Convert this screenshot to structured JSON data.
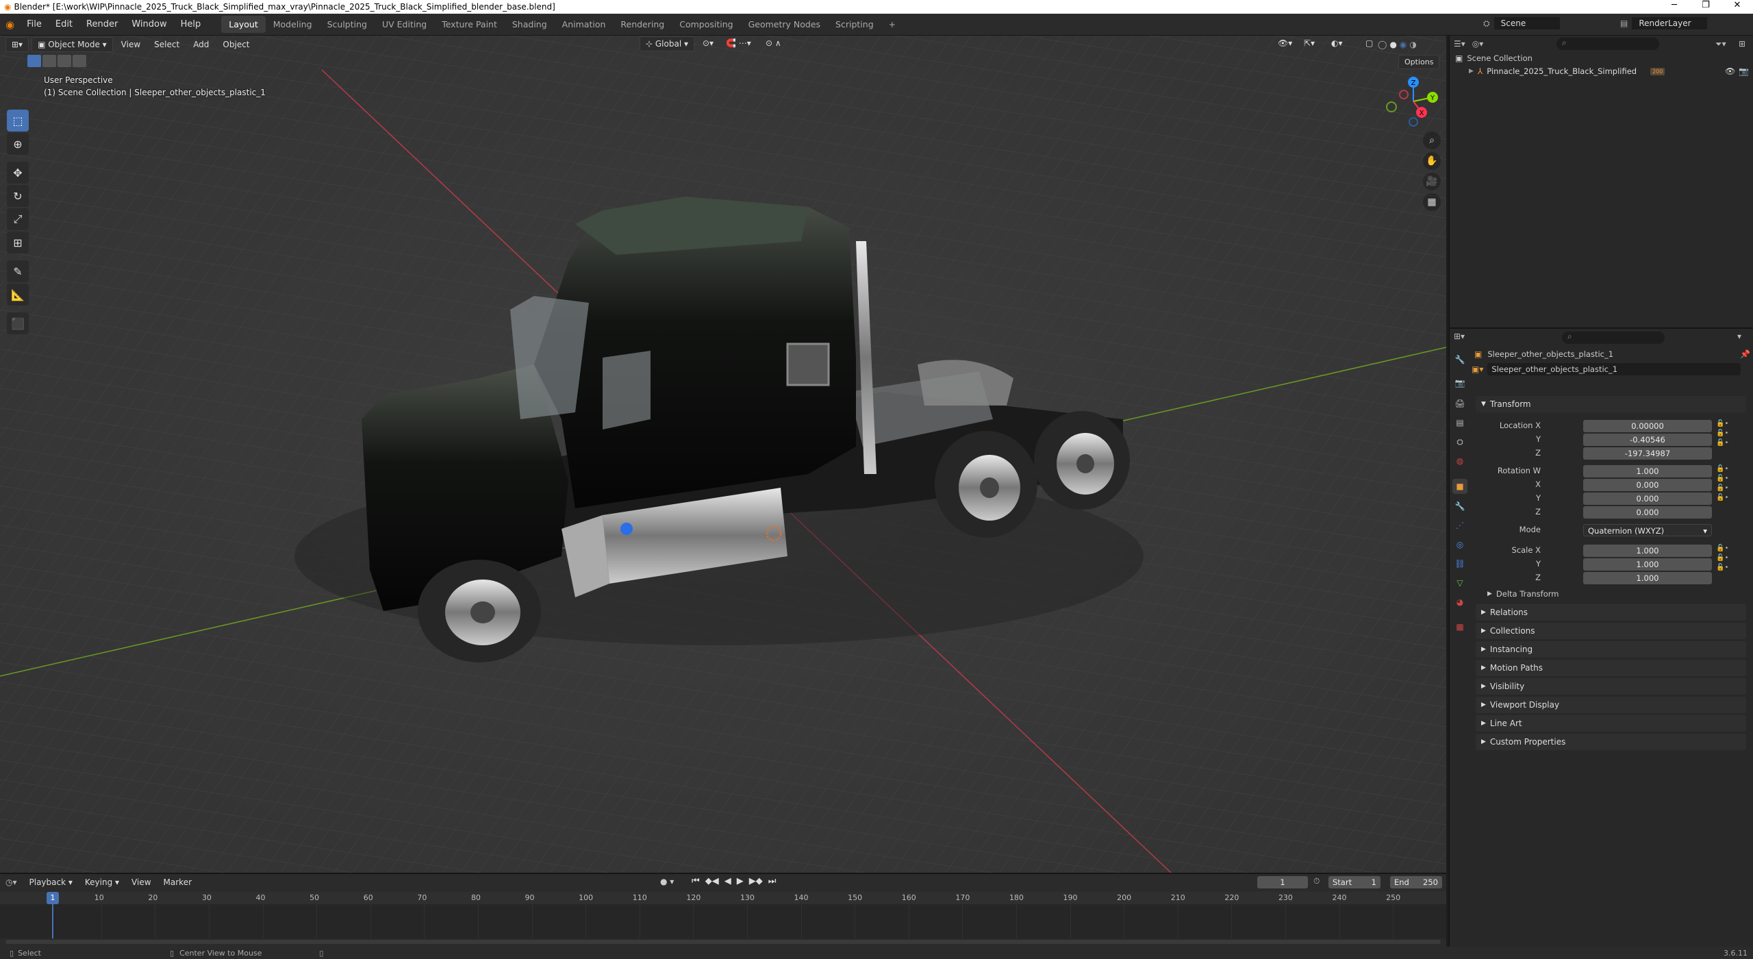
{
  "window": {
    "title": "Blender* [E:\\work\\WIP\\Pinnacle_2025_Truck_Black_Simplified_max_vray\\Pinnacle_2025_Truck_Black_Simplified_blender_base.blend]",
    "minimize": "─",
    "maximize": "❐",
    "close": "✕"
  },
  "menu": {
    "items": [
      "File",
      "Edit",
      "Render",
      "Window",
      "Help"
    ],
    "workspaces": [
      "Layout",
      "Modeling",
      "Sculpting",
      "UV Editing",
      "Texture Paint",
      "Shading",
      "Animation",
      "Rendering",
      "Compositing",
      "Geometry Nodes",
      "Scripting"
    ],
    "active_workspace": "Layout",
    "add_tab": "+",
    "scene": "Scene",
    "view_layer": "RenderLayer"
  },
  "viewport": {
    "mode": "Object Mode",
    "menus": [
      "View",
      "Select",
      "Add",
      "Object"
    ],
    "orientation": "Global",
    "options": "Options",
    "perspective": "User Perspective",
    "collection_info": "(1) Scene Collection | Sleeper_other_objects_plastic_1",
    "gizmo": {
      "x": "X",
      "y": "Y",
      "z": "Z"
    }
  },
  "outliner": {
    "root": "Scene Collection",
    "items": [
      {
        "name": "Pinnacle_2025_Truck_Black_Simplified",
        "badge": "200"
      }
    ]
  },
  "properties": {
    "object_name": "Sleeper_other_objects_plastic_1",
    "data_name": "Sleeper_other_objects_plastic_1",
    "transform_title": "Transform",
    "location_label": "Location X",
    "location": [
      "0.00000",
      "-0.40546",
      "-197.34987"
    ],
    "rotation_label": "Rotation W",
    "rotation": [
      "1.000",
      "0.000",
      "0.000",
      "0.000"
    ],
    "mode_label": "Mode",
    "mode_value": "Quaternion (WXYZ)",
    "scale_label": "Scale X",
    "scale": [
      "1.000",
      "1.000",
      "1.000"
    ],
    "axis_labels": [
      "X",
      "Y",
      "Z"
    ],
    "delta_transform": "Delta Transform",
    "panels": [
      "Relations",
      "Collections",
      "Instancing",
      "Motion Paths",
      "Visibility",
      "Viewport Display",
      "Line Art",
      "Custom Properties"
    ]
  },
  "timeline": {
    "menus": [
      "Playback",
      "Keying",
      "View",
      "Marker"
    ],
    "current_frame": "1",
    "start_label": "Start",
    "start": "1",
    "end_label": "End",
    "end": "250",
    "ticks": [
      "10",
      "20",
      "30",
      "40",
      "50",
      "60",
      "70",
      "80",
      "90",
      "100",
      "110",
      "120",
      "130",
      "140",
      "150",
      "160",
      "170",
      "180",
      "190",
      "200",
      "210",
      "220",
      "230",
      "240",
      "250"
    ],
    "playhead": "1"
  },
  "status": {
    "select": "Select",
    "center_view": "Center View to Mouse",
    "version": "3.6.11"
  },
  "colors": {
    "accent": "#4772b3",
    "x_axis": "#ff3352",
    "y_axis": "#8bdc00",
    "z_axis": "#2890ff"
  }
}
